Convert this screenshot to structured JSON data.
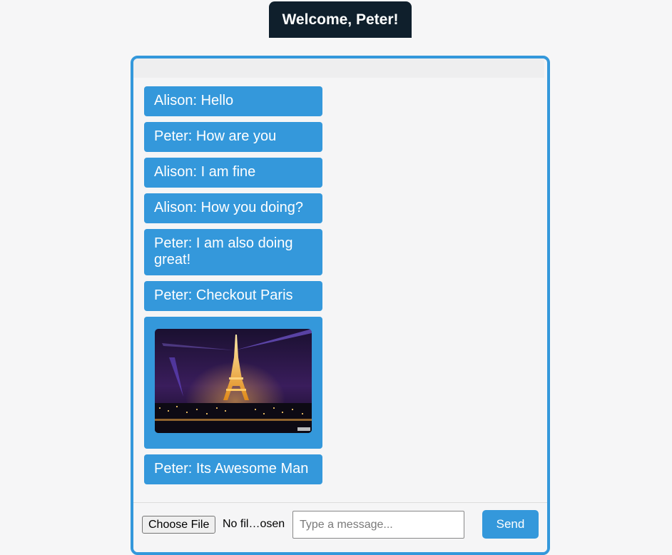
{
  "header": {
    "welcome": "Welcome, Peter!"
  },
  "messages": [
    {
      "type": "text",
      "text": "Alison: Hello"
    },
    {
      "type": "text",
      "text": "Peter: How are you"
    },
    {
      "type": "text",
      "text": "Alison: I am fine"
    },
    {
      "type": "text",
      "text": "Alison: How you doing?"
    },
    {
      "type": "text",
      "text": "Peter: I am also doing great!"
    },
    {
      "type": "text",
      "text": "Peter: Checkout Paris"
    },
    {
      "type": "image",
      "image": "eiffel-tower-night-photo"
    },
    {
      "type": "text",
      "text": "Peter: Its Awesome Man"
    }
  ],
  "composer": {
    "file_button_label": "Choose File",
    "file_status": "No fil…osen",
    "input_value": "",
    "input_placeholder": "Type a message...",
    "send_label": "Send"
  },
  "colors": {
    "accent": "#3498db",
    "header_bg": "#0f1f2c",
    "page_bg": "#f6f6f7"
  }
}
